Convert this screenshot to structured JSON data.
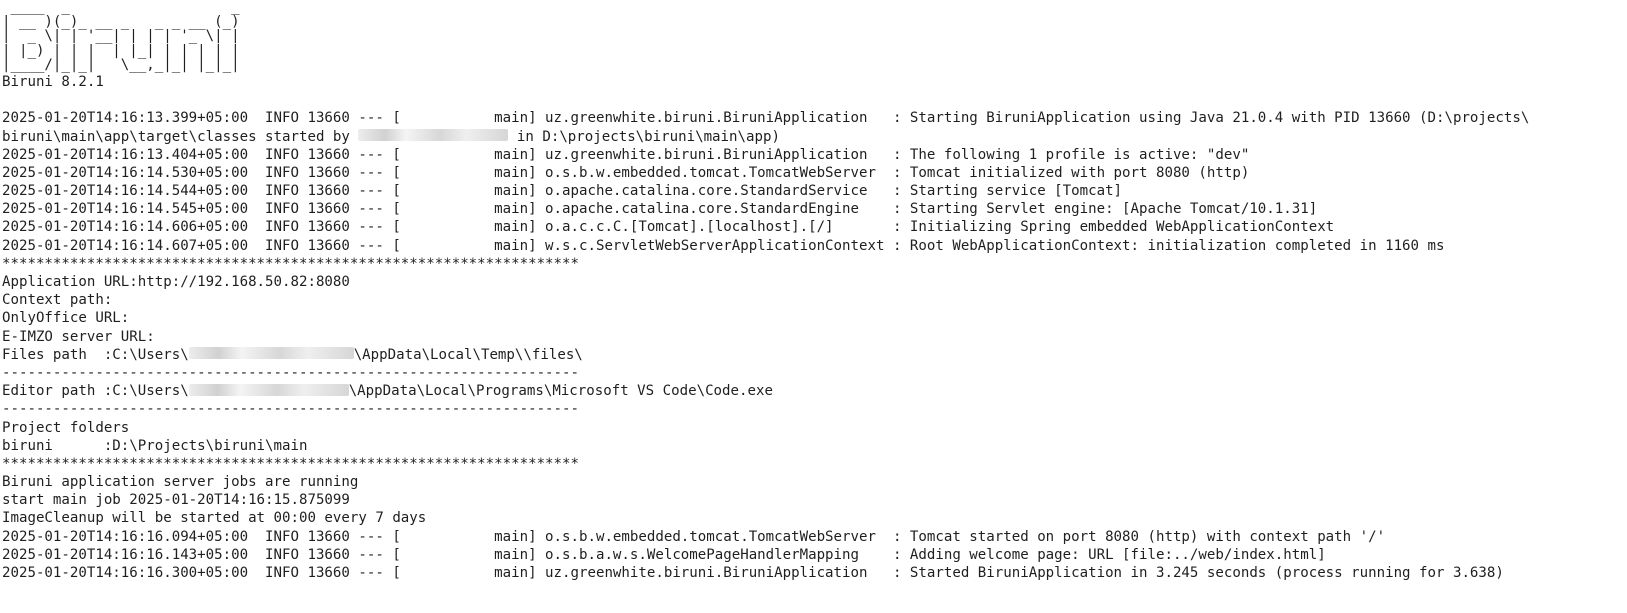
{
  "banner": [
    " ____  _                   _ ",
    "| __ )(_)_ __ _   _ _ __ (_)",
    "|  _ \\| | '__| | | | '_ \\| |",
    "| |_) | | |  | |_| | | | | |",
    "|____/|_|_|   \\__,_|_| |_|_|"
  ],
  "version": "Biruni 8.2.1",
  "startup_log": [
    "2025-01-20T14:16:13.399+05:00  INFO 13660 --- [           main] uz.greenwhite.biruni.BiruniApplication   : Starting BiruniApplication using Java 21.0.4 with PID 13660 (D:\\projects\\",
    "in D:\\projects\\biruni\\main\\app)",
    "2025-01-20T14:16:13.404+05:00  INFO 13660 --- [           main] uz.greenwhite.biruni.BiruniApplication   : The following 1 profile is active: \"dev\"",
    "2025-01-20T14:16:14.530+05:00  INFO 13660 --- [           main] o.s.b.w.embedded.tomcat.TomcatWebServer  : Tomcat initialized with port 8080 (http)",
    "2025-01-20T14:16:14.544+05:00  INFO 13660 --- [           main] o.apache.catalina.core.StandardService   : Starting service [Tomcat]",
    "2025-01-20T14:16:14.545+05:00  INFO 13660 --- [           main] o.apache.catalina.core.StandardEngine    : Starting Servlet engine: [Apache Tomcat/10.1.31]",
    "2025-01-20T14:16:14.606+05:00  INFO 13660 --- [           main] o.a.c.c.C.[Tomcat].[localhost].[/]       : Initializing Spring embedded WebApplicationContext",
    "2025-01-20T14:16:14.607+05:00  INFO 13660 --- [           main] w.s.c.ServletWebServerApplicationContext : Root WebApplicationContext: initialization completed in 1160 ms"
  ],
  "started_by_prefix": "biruni\\main\\app\\target\\classes started by ",
  "separator_stars": "********************************************************************",
  "separator_dashes": "--------------------------------------------------------------------",
  "config": {
    "app_url": "Application URL:http://192.168.50.82:8080",
    "context_path": "Context path:",
    "onlyoffice_url": "OnlyOffice URL:",
    "eimzo_url": "E-IMZO server URL:",
    "files_path_prefix": "Files path  :C:\\Users\\",
    "files_path_suffix": "\\AppData\\Local\\Temp\\\\files\\",
    "editor_path_prefix": "Editor path :C:\\Users\\",
    "editor_path_suffix": "\\AppData\\Local\\Programs\\Microsoft VS Code\\Code.exe"
  },
  "project": {
    "heading": "Project folders",
    "entry": "biruni      :D:\\Projects\\biruni\\main"
  },
  "jobs": [
    "Biruni application server jobs are running",
    "start main job 2025-01-20T14:16:15.875099",
    "ImageCleanup will be started at 00:00 every 7 days"
  ],
  "final_log": [
    "2025-01-20T14:16:16.094+05:00  INFO 13660 --- [           main] o.s.b.w.embedded.tomcat.TomcatWebServer  : Tomcat started on port 8080 (http) with context path '/'",
    "2025-01-20T14:16:16.143+05:00  INFO 13660 --- [           main] o.s.b.a.w.s.WelcomePageHandlerMapping    : Adding welcome page: URL [file:../web/index.html]",
    "2025-01-20T14:16:16.300+05:00  INFO 13660 --- [           main] uz.greenwhite.biruni.BiruniApplication   : Started BiruniApplication in 3.245 seconds (process running for 3.638)"
  ]
}
